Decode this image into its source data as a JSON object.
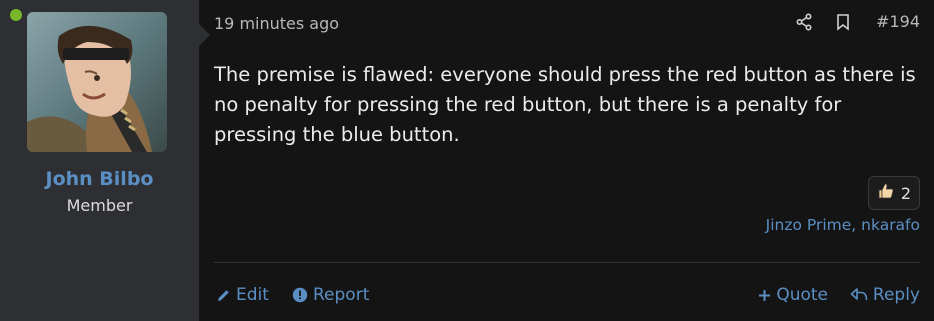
{
  "user": {
    "name": "John Bilbo",
    "title": "Member",
    "avatar_icon": "avatar-image",
    "online": true,
    "online_color": "#76b82a"
  },
  "post": {
    "timestamp": "19 minutes ago",
    "number": "#194",
    "body": "The premise is flawed: everyone should press the red button as there is no penalty for pressing the red button, but there is a penalty for pressing the blue button.",
    "reaction": {
      "icon": "thumbs-up-icon",
      "count": "2"
    },
    "reactors": "Jinzo Prime, nkarafo"
  },
  "header_actions": {
    "share_icon": "share-icon",
    "bookmark_icon": "bookmark-icon"
  },
  "footer": {
    "edit_label": "Edit",
    "report_label": "Report",
    "quote_label": "Quote",
    "reply_label": "Reply"
  },
  "colors": {
    "link": "#5b8fc3",
    "background": "#141414",
    "user_panel": "#2d2f33"
  }
}
